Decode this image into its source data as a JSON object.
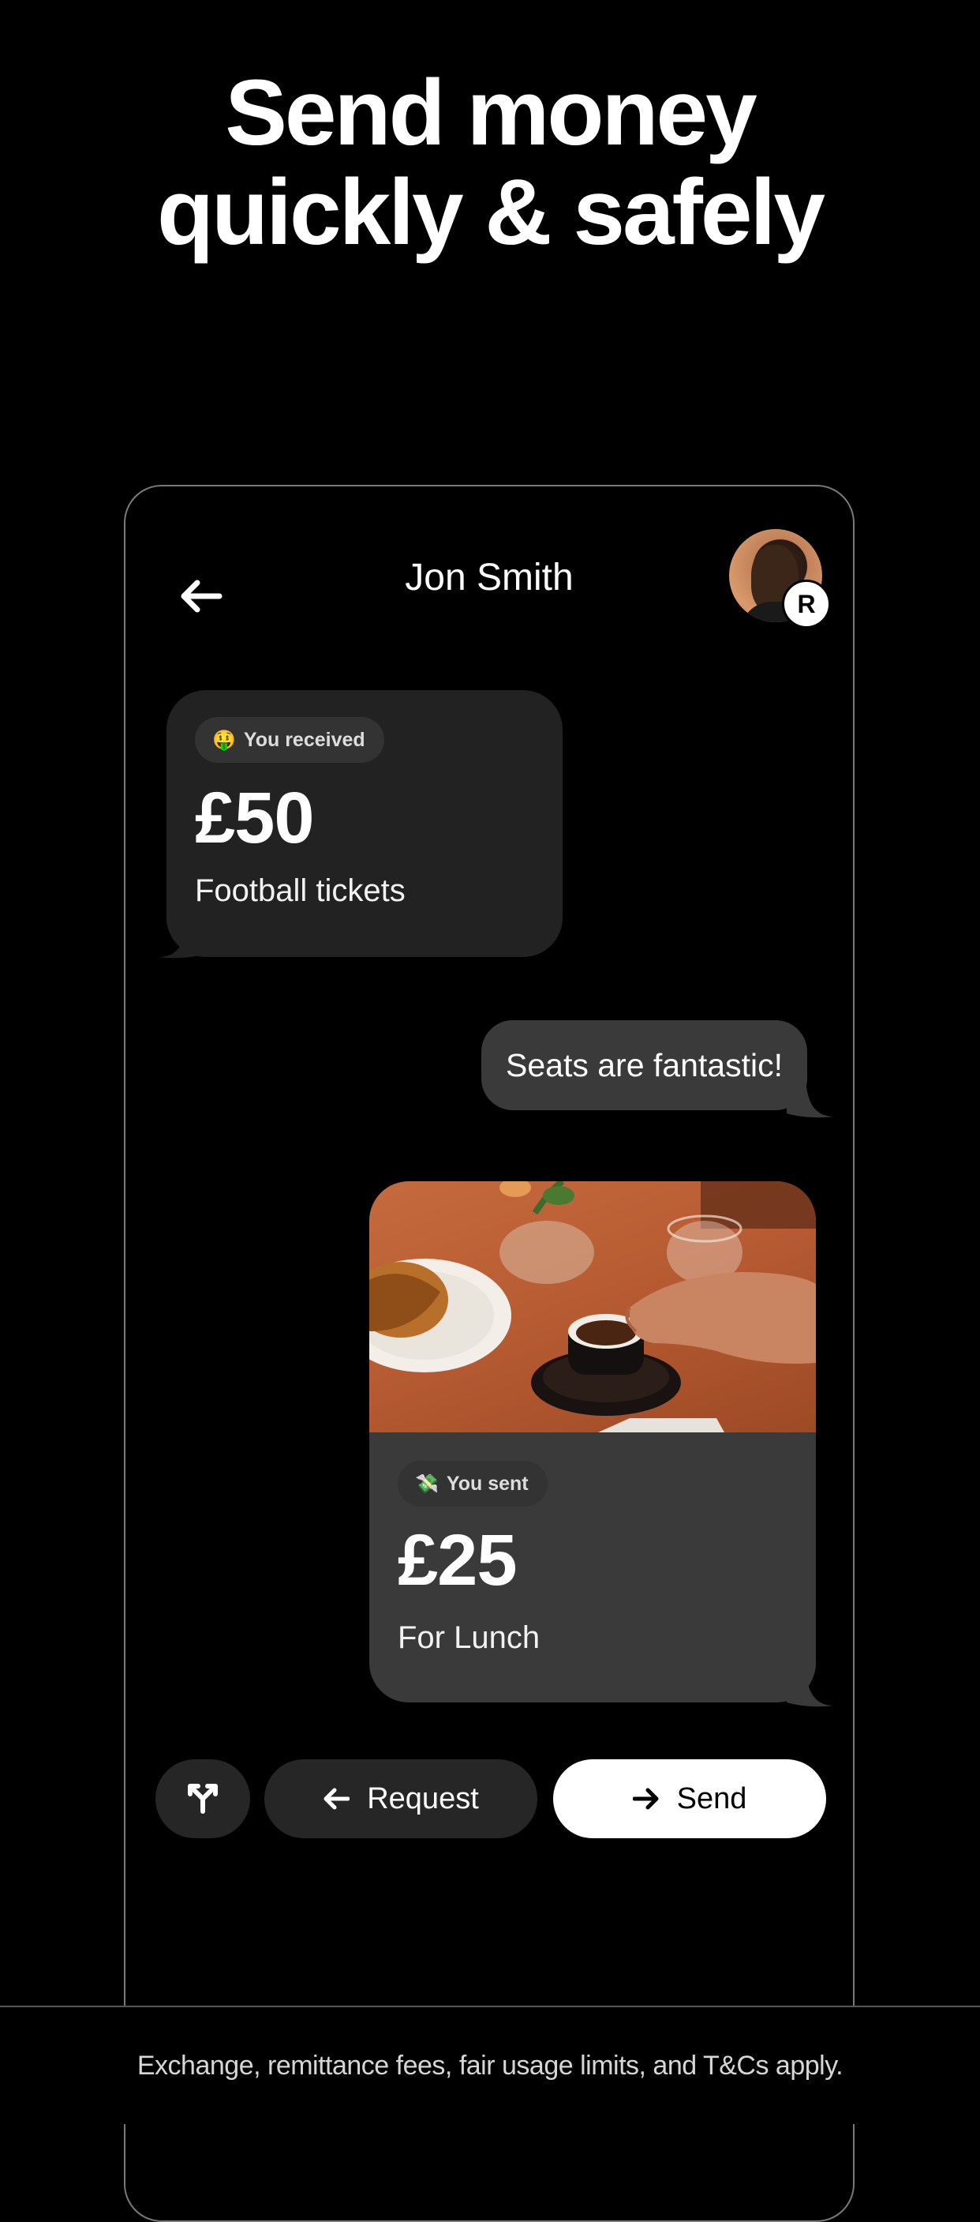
{
  "headline": {
    "line1": "Send money",
    "line2": "quickly & safely"
  },
  "chat": {
    "contact_name": "Jon Smith",
    "avatar_badge": "R",
    "received": {
      "label": "You received",
      "emoji": "🤑",
      "amount": "£50",
      "note": "Football tickets"
    },
    "message": "Seats are fantastic!",
    "sent": {
      "label": "You sent",
      "emoji": "💸",
      "amount": "£25",
      "note": "For Lunch"
    }
  },
  "actions": {
    "request_label": "Request",
    "send_label": "Send"
  },
  "footer": {
    "disclaimer": "Exchange, remittance fees, fair usage limits, and T&Cs apply."
  }
}
